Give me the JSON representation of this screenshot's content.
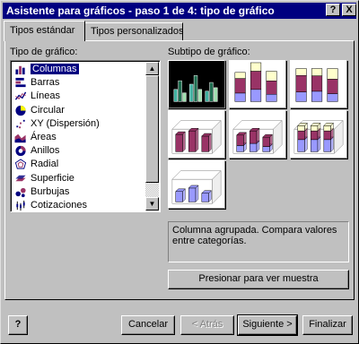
{
  "window": {
    "title": "Asistente para gráficos - paso 1 de 4: tipo de gráfico",
    "help_btn": "?",
    "close_btn": "X"
  },
  "tabs": [
    {
      "label": "Tipos estándar",
      "active": true
    },
    {
      "label": "Tipos personalizados",
      "active": false
    }
  ],
  "chart_type": {
    "label": "Tipo de gráfico:",
    "items": [
      {
        "label": "Columnas",
        "icon": "column-chart-icon",
        "selected": true
      },
      {
        "label": "Barras",
        "icon": "bar-chart-icon"
      },
      {
        "label": "Líneas",
        "icon": "line-chart-icon"
      },
      {
        "label": "Circular",
        "icon": "pie-chart-icon"
      },
      {
        "label": "XY (Dispersión)",
        "icon": "scatter-chart-icon"
      },
      {
        "label": "Áreas",
        "icon": "area-chart-icon"
      },
      {
        "label": "Anillos",
        "icon": "doughnut-chart-icon"
      },
      {
        "label": "Radial",
        "icon": "radar-chart-icon"
      },
      {
        "label": "Superficie",
        "icon": "surface-chart-icon"
      },
      {
        "label": "Burbujas",
        "icon": "bubble-chart-icon"
      },
      {
        "label": "Cotizaciones",
        "icon": "stock-chart-icon"
      }
    ]
  },
  "subtype": {
    "label": "Subtipo de gráfico:",
    "items": [
      {
        "name": "clustered-column",
        "selected": true
      },
      {
        "name": "stacked-column"
      },
      {
        "name": "100-stacked-column"
      },
      {
        "name": "3d-clustered-column"
      },
      {
        "name": "3d-stacked-column"
      },
      {
        "name": "3d-100-stacked-column"
      },
      {
        "name": "3d-column"
      }
    ],
    "description": "Columna agrupada. Compara valores entre categorías."
  },
  "buttons": {
    "preview": "Presionar para ver muestra",
    "help": "?",
    "cancel": "Cancelar",
    "back": "< Atrás",
    "next": "Siguiente >",
    "finish": "Finalizar"
  },
  "colors": {
    "title_bar": "#000080",
    "face": "#c0c0c0",
    "series_1": "#9999ff",
    "series_2": "#993366",
    "series_3": "#ffffcc",
    "selected_bg": "#000080"
  }
}
